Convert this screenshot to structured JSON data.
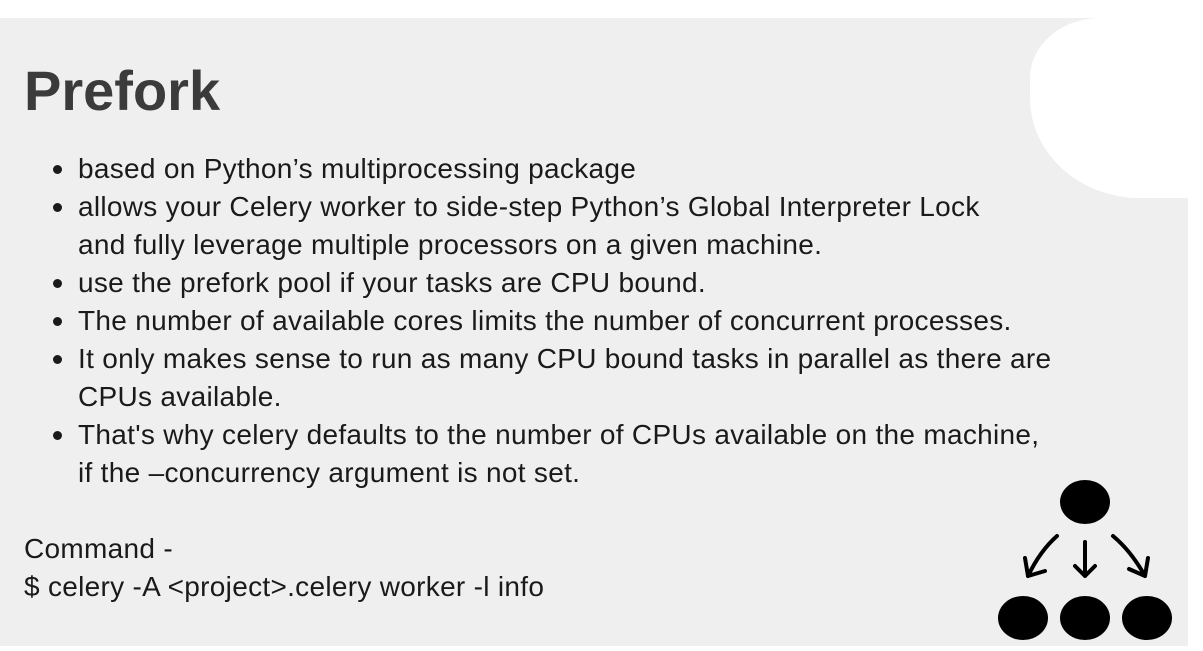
{
  "title": "Prefork",
  "bullets": [
    {
      "lines": [
        "based on Python’s multiprocessing package"
      ]
    },
    {
      "lines": [
        "allows your Celery worker to side-step Python’s Global Interpreter Lock",
        "and fully leverage multiple processors on a given machine."
      ]
    },
    {
      "lines": [
        "use the prefork pool if your tasks are CPU bound."
      ]
    },
    {
      "lines": [
        "The number of available cores limits the number of concurrent processes."
      ]
    },
    {
      "lines": [
        "It only makes sense to run as many CPU bound tasks in parallel as there are",
        "CPUs available."
      ]
    },
    {
      "lines": [
        "That's why celery defaults to the number of CPUs available on the machine,",
        "if the –concurrency argument is not set."
      ]
    }
  ],
  "command": {
    "label": "Command -",
    "text": "$ celery -A <project>.celery worker -l info"
  },
  "diagram_icon": "process-fork-icon"
}
